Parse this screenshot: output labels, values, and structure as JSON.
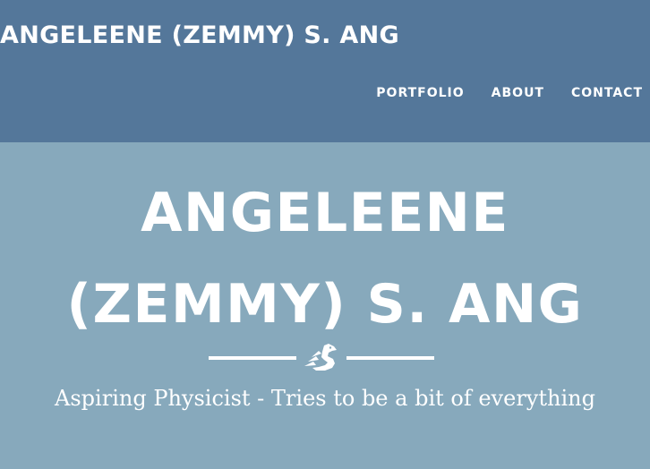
{
  "header": {
    "site_title": "ANGELEENE (ZEMMY) S. ANG",
    "nav": [
      {
        "label": "PORTFOLIO"
      },
      {
        "label": "ABOUT"
      },
      {
        "label": "CONTACT"
      }
    ]
  },
  "hero": {
    "title_line1": "ANGELEENE",
    "title_line2": "(ZEMMY) S. ANG",
    "divider_icon": "dragon-emblem-icon",
    "subtitle": "Aspiring Physicist - Tries to be a bit of everything"
  },
  "colors": {
    "navbar_bg": "#54779a",
    "hero_bg": "#87a9bc",
    "text": "#ffffff"
  }
}
